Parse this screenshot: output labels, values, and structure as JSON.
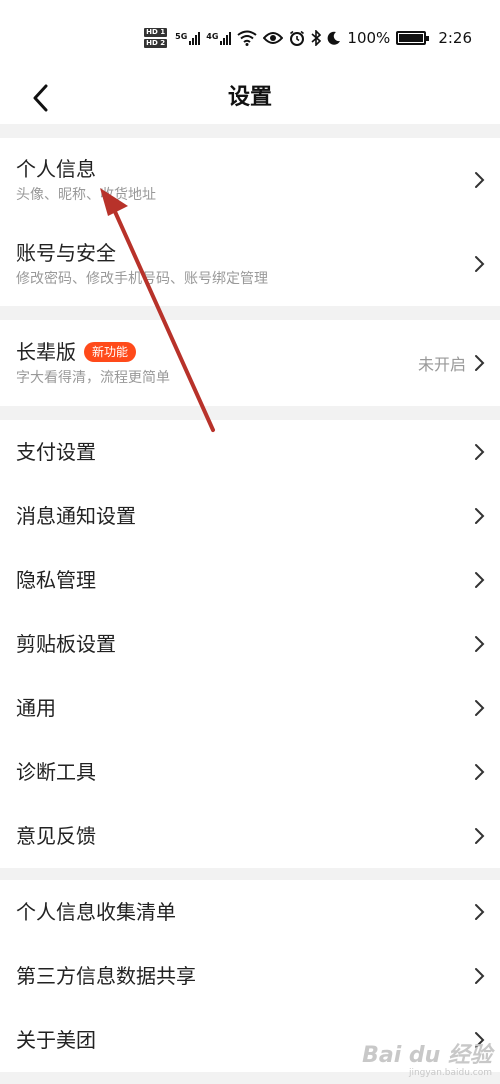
{
  "status_bar": {
    "sim1": "HD 1",
    "sim2": "HD 2",
    "net1": "5G",
    "net2": "4G",
    "battery": "100%",
    "time": "2:26",
    "icons": [
      "wifi-icon",
      "eye-icon",
      "alarm-icon",
      "bluetooth-icon",
      "moon-icon",
      "battery-icon"
    ]
  },
  "nav": {
    "title": "设置",
    "back_icon": "chevron-left-icon"
  },
  "groups": {
    "account": {
      "items": [
        {
          "title": "个人信息",
          "subtitle": "头像、昵称、收货地址"
        },
        {
          "title": "账号与安全",
          "subtitle": "修改密码、修改手机号码、账号绑定管理"
        }
      ]
    },
    "elder": {
      "title": "长辈版",
      "badge": "新功能",
      "subtitle": "字大看得清，流程更简单",
      "status": "未开启"
    },
    "general": {
      "items": [
        {
          "title": "支付设置"
        },
        {
          "title": "消息通知设置"
        },
        {
          "title": "隐私管理"
        },
        {
          "title": "剪贴板设置"
        },
        {
          "title": "通用"
        },
        {
          "title": "诊断工具"
        },
        {
          "title": "意见反馈"
        }
      ]
    },
    "about": {
      "items": [
        {
          "title": "个人信息收集清单"
        },
        {
          "title": "第三方信息数据共享"
        },
        {
          "title": "关于美团"
        }
      ]
    }
  },
  "colors": {
    "accent": "#ff4a1a",
    "annotation_arrow": "#b8322a",
    "background": "#f2f2f2",
    "subtitle": "#999999"
  },
  "watermark": {
    "main": "Bai du 经验",
    "sub": "jingyan.baidu.com"
  }
}
